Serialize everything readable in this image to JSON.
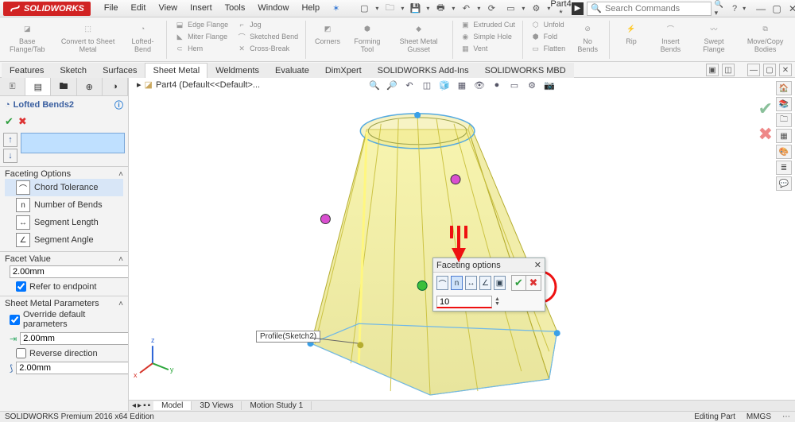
{
  "app": {
    "logo_text": "SOLIDWORKS",
    "doc_title": "Part4 *"
  },
  "menu": {
    "file": "File",
    "edit": "Edit",
    "view": "View",
    "insert": "Insert",
    "tools": "Tools",
    "window": "Window",
    "help": "Help"
  },
  "search": {
    "placeholder": "Search Commands"
  },
  "ribbon": {
    "base_flange": "Base Flange/Tab",
    "convert": "Convert to Sheet Metal",
    "lofted": "Lofted-Bend",
    "edge_flange": "Edge Flange",
    "miter": "Miter Flange",
    "hem": "Hem",
    "jog": "Jog",
    "sketched_bend": "Sketched Bend",
    "cross_break": "Cross-Break",
    "corners": "Corners",
    "forming": "Forming Tool",
    "gusset": "Sheet Metal Gusset",
    "extruded_cut": "Extruded Cut",
    "simple_hole": "Simple Hole",
    "vent": "Vent",
    "unfold": "Unfold",
    "fold": "Fold",
    "flatten": "Flatten",
    "no_bends": "No Bends",
    "rip": "Rip",
    "insert_bends": "Insert Bends",
    "swept_flange": "Swept Flange",
    "move_copy": "Move/Copy Bodies"
  },
  "cmdtabs": {
    "features": "Features",
    "sketch": "Sketch",
    "surfaces": "Surfaces",
    "sheet_metal": "Sheet Metal",
    "weldments": "Weldments",
    "evaluate": "Evaluate",
    "dimxpert": "DimXpert",
    "addins": "SOLIDWORKS Add-Ins",
    "mbd": "SOLIDWORKS MBD"
  },
  "fm": {
    "title": "Lofted Bends2",
    "sections": {
      "faceting": "Faceting Options",
      "chord": "Chord Tolerance",
      "nbends": "Number of Bends",
      "seglen": "Segment Length",
      "segang": "Segment Angle",
      "facet_value": "Facet Value",
      "facet_value_v": "2.00mm",
      "refer": "Refer to endpoint",
      "smp": "Sheet Metal Parameters",
      "override": "Override default parameters",
      "thk": "2.00mm",
      "reverse": "Reverse direction",
      "rad": "2.00mm"
    }
  },
  "breadcrumb": {
    "part": "Part4  (Default<<Default>..."
  },
  "callout": {
    "profile": "Profile(Sketch2)"
  },
  "popup": {
    "title": "Faceting options",
    "value": "10"
  },
  "bottom_tabs": {
    "model": "Model",
    "views": "3D Views",
    "motion": "Motion Study 1"
  },
  "status": {
    "left": "SOLIDWORKS Premium 2016 x64 Edition",
    "mid": "Editing Part",
    "right": "MMGS"
  }
}
